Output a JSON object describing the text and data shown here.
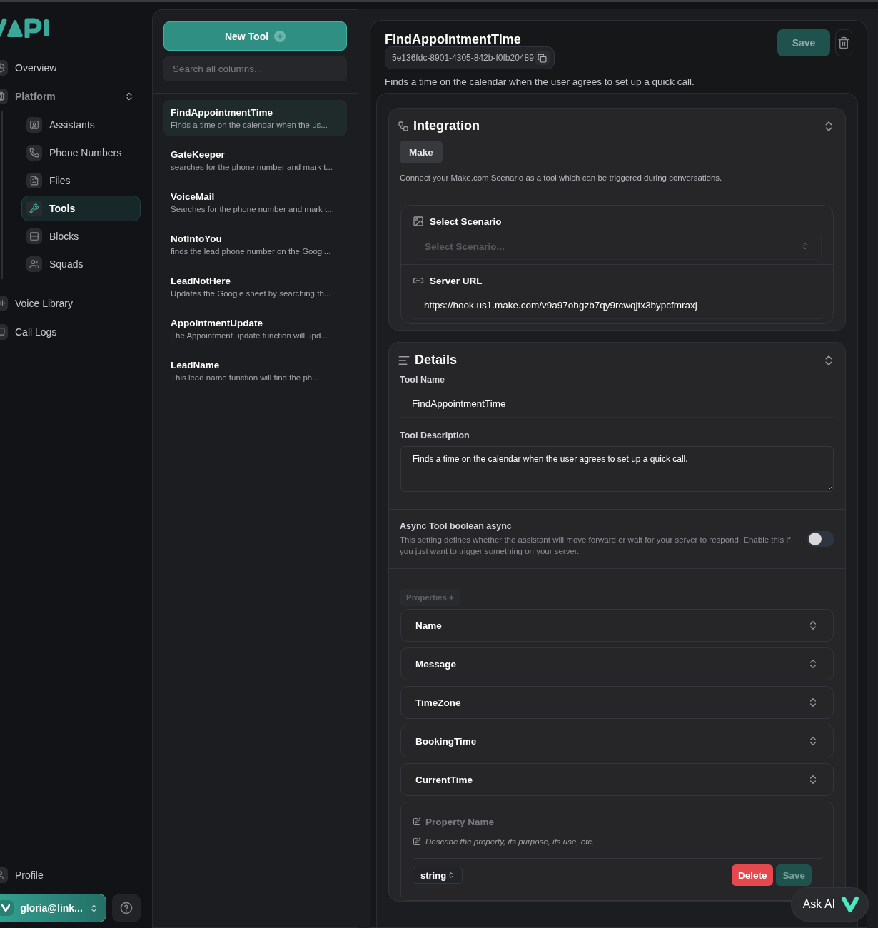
{
  "sidebar": {
    "items": [
      {
        "label": "Overview",
        "kind": "link",
        "selected": false
      },
      {
        "label": "Platform",
        "kind": "group",
        "expanded": true,
        "children": [
          {
            "label": "Assistants",
            "selected": false
          },
          {
            "label": "Phone Numbers",
            "selected": false
          },
          {
            "label": "Files",
            "selected": false
          },
          {
            "label": "Tools",
            "selected": true
          },
          {
            "label": "Blocks",
            "selected": false
          },
          {
            "label": "Squads",
            "selected": false
          }
        ]
      },
      {
        "label": "Voice Library",
        "kind": "link",
        "selected": false
      },
      {
        "label": "Call Logs",
        "kind": "link",
        "selected": false
      }
    ],
    "profile": "Profile",
    "account": "gloria@link..."
  },
  "tool_list": {
    "new_button": "New Tool",
    "search": {
      "placeholder": "Search all columns..."
    },
    "items": [
      {
        "name": "FindAppointmentTime",
        "description": "Finds a time on the calendar when the us...",
        "selected": true
      },
      {
        "name": "GateKeeper",
        "description": "searches for the phone number and mark t...",
        "selected": false
      },
      {
        "name": "VoiceMail",
        "description": "Searches for the phone number and mark t...",
        "selected": false
      },
      {
        "name": "NotIntoYou",
        "description": "finds the lead phone number on the Googl...",
        "selected": false
      },
      {
        "name": "LeadNotHere",
        "description": "Updates the Google sheet by searching th...",
        "selected": false
      },
      {
        "name": "AppointmentUpdate",
        "description": "The Appointment update function will upd...",
        "selected": false
      },
      {
        "name": "LeadName",
        "description": "This lead name function will find the ph...",
        "selected": false
      }
    ]
  },
  "detail": {
    "title": "FindAppointmentTime",
    "save": "Save",
    "id": "5e136fdc-8901-4305-842b-f0fb20489",
    "description": "Finds a time on the calendar when the user agrees to set up a quick call.",
    "integration": {
      "title": "Integration",
      "provider": "Make",
      "note": "Connect your Make.com Scenario as a tool which can be triggered during conversations.",
      "scenario_label": "Select Scenario",
      "scenario": {
        "placeholder": "Select Scenario..."
      },
      "server_label": "Server URL",
      "server_url": "https://hook.us1.make.com/v9a97ohgzb7qy9rcwqjtx3bypcfmraxj"
    },
    "details": {
      "title": "Details",
      "name_label": "Tool Name",
      "name": "FindAppointmentTime",
      "description_label": "Tool Description",
      "description_value": "Finds a time on the calendar when the user agrees to set up a quick call.",
      "async": {
        "label": "Async Tool boolean async",
        "help": "This setting defines whether the assistant will move forward or wait for your server to respond. Enable this if you just want to trigger something on your server.",
        "on": false
      },
      "properties_button": "Properties +",
      "properties": [
        {
          "name": "Name"
        },
        {
          "name": "Message"
        },
        {
          "name": "TimeZone"
        },
        {
          "name": "BookingTime"
        },
        {
          "name": "CurrentTime"
        }
      ],
      "new_property": {
        "name": {
          "placeholder": "Property Name"
        },
        "description": {
          "placeholder": "Describe the property, its purpose, its use, etc."
        },
        "type": "string",
        "delete": "Delete",
        "save": "Save"
      }
    }
  },
  "ask_ai": "Ask AI"
}
